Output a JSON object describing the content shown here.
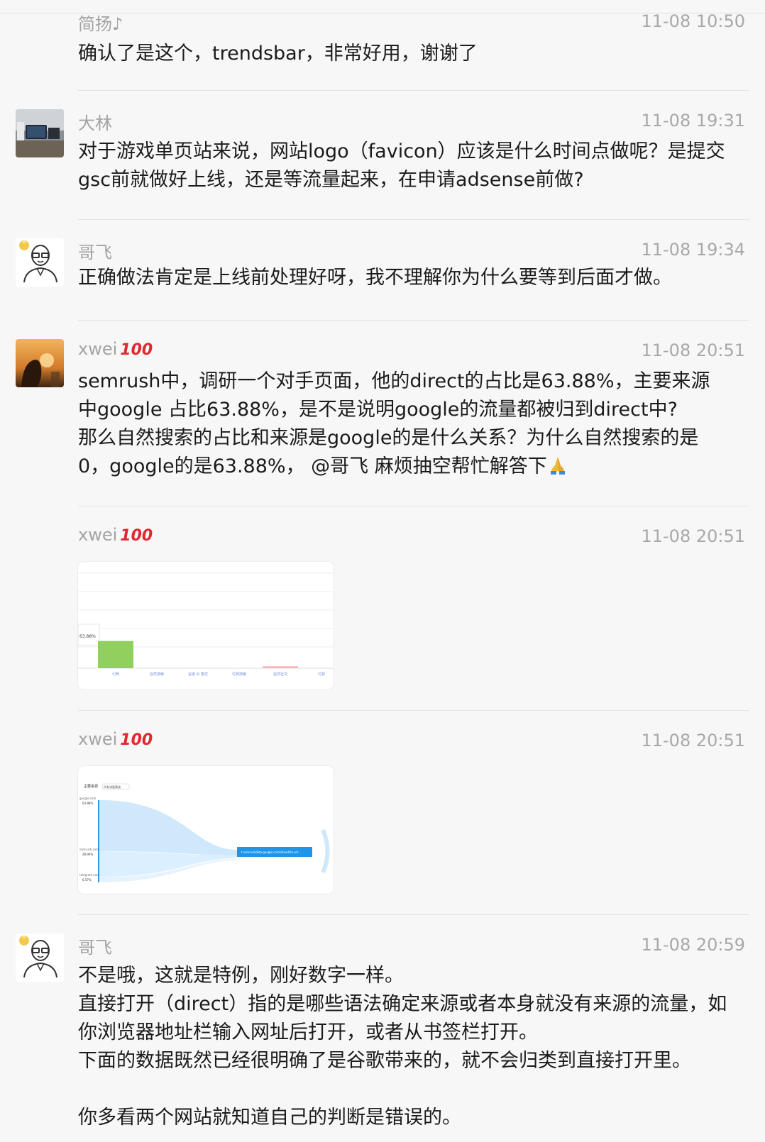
{
  "messages": [
    {
      "sender": "简扬♪",
      "time": "11-08 10:50",
      "lines": [
        "确认了是这个，trendsbar，非常好用，谢谢了"
      ]
    },
    {
      "sender": "大林",
      "time": "11-08 19:31",
      "lines": [
        "对于游戏单页站来说，网站logo（favicon）应该是什么时间点做呢？是提交",
        "gsc前就做好上线，还是等流量起来，在申请adsense前做?"
      ]
    },
    {
      "sender": "哥飞",
      "time": "11-08 19:34",
      "lines": [
        "正确做法肯定是上线前处理好呀，我不理解你为什么要等到后面才做。"
      ]
    },
    {
      "sender": "xwei",
      "badge": "100",
      "time": "11-08 20:51",
      "lines": [
        "semrush中，调研一个对手页面，他的direct的占比是63.88%，主要来源",
        "中google 占比63.88%，是不是说明google的流量都被归到direct中?",
        "那么自然搜索的占比和来源是google的是什么关系？为什么自然搜索的是",
        "0，google的是63.88%， @哥飞 麻烦抽空帮忙解答下"
      ]
    },
    {
      "sender": "xwei",
      "badge": "100",
      "time": "11-08 20:51",
      "image": {
        "highlight_value": "63.88%",
        "bar_values": [
          63.88,
          0,
          0,
          0,
          4.5,
          0
        ],
        "categories": [
          "引荐",
          "自然搜索",
          "谷歌 AI 模式",
          "付费搜索",
          "自然社交",
          "付费"
        ]
      }
    },
    {
      "sender": "xwei",
      "badge": "100",
      "time": "11-08 20:51",
      "image": {
        "title": "主要来源",
        "filter": "所有流量渠道",
        "sources": [
          {
            "name": "google.com",
            "pct": "63.88%"
          },
          {
            "name": "semrush.com",
            "pct": "28.96%"
          },
          {
            "name": "telegram.com",
            "pct": "6.57%"
          }
        ],
        "target": "t.semrushdata.google.com/sitewhite-url..."
      }
    },
    {
      "sender": "哥飞",
      "time": "11-08 20:59",
      "lines": [
        "不是哦，这就是特例，刚好数字一样。",
        "直接打开（direct）指的是哪些语法确定来源或者本身就没有来源的流量，如",
        "你浏览器地址栏输入网址后打开，或者从书签栏打开。",
        "下面的数据既然已经很明确了是谷歌带来的，就不会归类到直接打开里。",
        "",
        "你多看两个网站就知道自己的判断是错误的。"
      ]
    }
  ]
}
